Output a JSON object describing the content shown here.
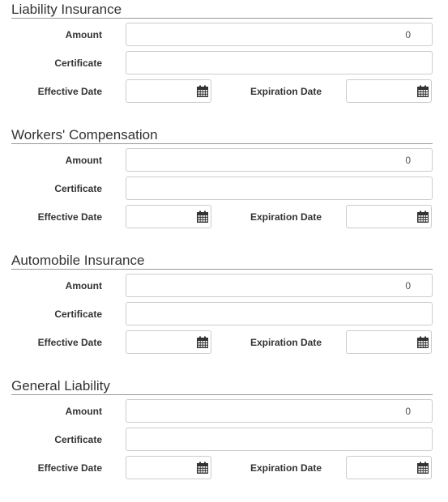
{
  "labels": {
    "amount": "Amount",
    "certificate": "Certificate",
    "effective_date": "Effective Date",
    "expiration_date": "Expiration Date"
  },
  "sections": [
    {
      "title": "Liability Insurance",
      "amount": "0",
      "certificate": "",
      "effective_date": "",
      "expiration_date": ""
    },
    {
      "title": "Workers' Compensation",
      "amount": "0",
      "certificate": "",
      "effective_date": "",
      "expiration_date": ""
    },
    {
      "title": "Automobile Insurance",
      "amount": "0",
      "certificate": "",
      "effective_date": "",
      "expiration_date": ""
    },
    {
      "title": "General Liability",
      "amount": "0",
      "certificate": "",
      "effective_date": "",
      "expiration_date": ""
    }
  ],
  "icons": {
    "date_picker": "calendar-icon"
  },
  "colors": {
    "border": "#cccccc",
    "rule": "#999999",
    "text": "#333333"
  }
}
